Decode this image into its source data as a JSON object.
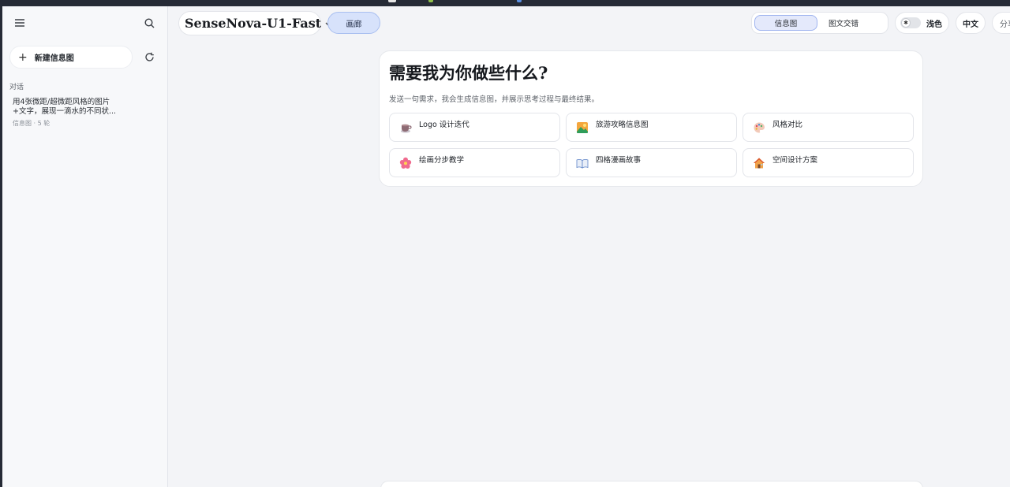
{
  "sidebar": {
    "new_label": "新建信息图",
    "section_label": "对话",
    "conversations": [
      {
        "title_line1": "用4张微距/超微距风格的图片",
        "title_line2": "+文字，展现一滴水的不同状...",
        "meta": "信息图 · 5 轮"
      }
    ]
  },
  "header": {
    "model_name": "SenseNova-U1-Fast",
    "gallery_label": "画廊",
    "modes": [
      "信息图",
      "图文交错"
    ],
    "active_mode": "信息图",
    "theme_label": "浅色",
    "lang_label": "中文",
    "share_label": "分享"
  },
  "main": {
    "title": "需要我为你做些什么?",
    "subtitle": "发送一句需求，我会生成信息图，并展示思考过程与最终结果。",
    "suggestions": [
      {
        "label": "Logo 设计迭代",
        "icon": "coffee-cup-icon"
      },
      {
        "label": "旅游攻略信息图",
        "icon": "landscape-icon"
      },
      {
        "label": "风格对比",
        "icon": "palette-icon"
      },
      {
        "label": "绘画分步教学",
        "icon": "flower-icon"
      },
      {
        "label": "四格漫画故事",
        "icon": "book-icon"
      },
      {
        "label": "空间设计方案",
        "icon": "house-icon"
      }
    ]
  },
  "colors": {
    "accent": "#d7e2fb",
    "accent_border": "#a9bff0",
    "background": "#f3f4f7"
  }
}
